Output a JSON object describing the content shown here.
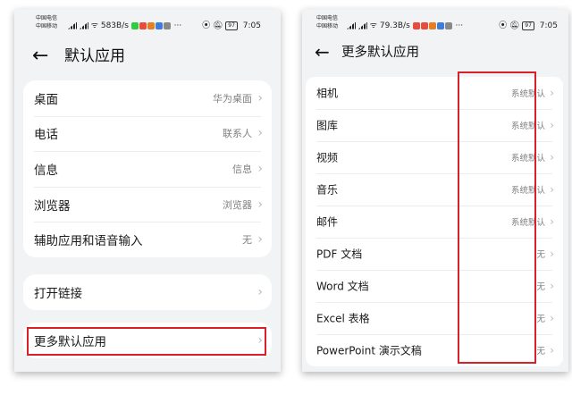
{
  "left_screen": {
    "status_bar": {
      "carrier1": "中国电信",
      "carrier2": "中国移动",
      "speed": "583B/s",
      "battery": "97",
      "time": "7:05"
    },
    "title": "默认应用",
    "group1": [
      {
        "label": "桌面",
        "value": "华为桌面"
      },
      {
        "label": "电话",
        "value": "联系人"
      },
      {
        "label": "信息",
        "value": "信息"
      },
      {
        "label": "浏览器",
        "value": "浏览器"
      },
      {
        "label": "辅助应用和语音输入",
        "value": "无"
      }
    ],
    "open_links_label": "打开链接",
    "more_defaults_label": "更多默认应用"
  },
  "right_screen": {
    "status_bar": {
      "carrier1": "中国电信",
      "carrier2": "中国移动",
      "speed": "79.3B/s",
      "battery": "97",
      "time": "7:05"
    },
    "title": "更多默认应用",
    "items": [
      {
        "label": "相机",
        "value": "系统默认"
      },
      {
        "label": "图库",
        "value": "系统默认"
      },
      {
        "label": "视频",
        "value": "系统默认"
      },
      {
        "label": "音乐",
        "value": "系统默认"
      },
      {
        "label": "邮件",
        "value": "系统默认"
      },
      {
        "label": "PDF 文档",
        "value": "无"
      },
      {
        "label": "Word 文档",
        "value": "无"
      },
      {
        "label": "Excel 表格",
        "value": "无"
      },
      {
        "label": "PowerPoint 演示文稿",
        "value": "无"
      }
    ]
  },
  "colors": {
    "highlight": "#d8202a",
    "background": "#f1f3f5",
    "card": "#ffffff",
    "secondary_text": "#808080"
  }
}
